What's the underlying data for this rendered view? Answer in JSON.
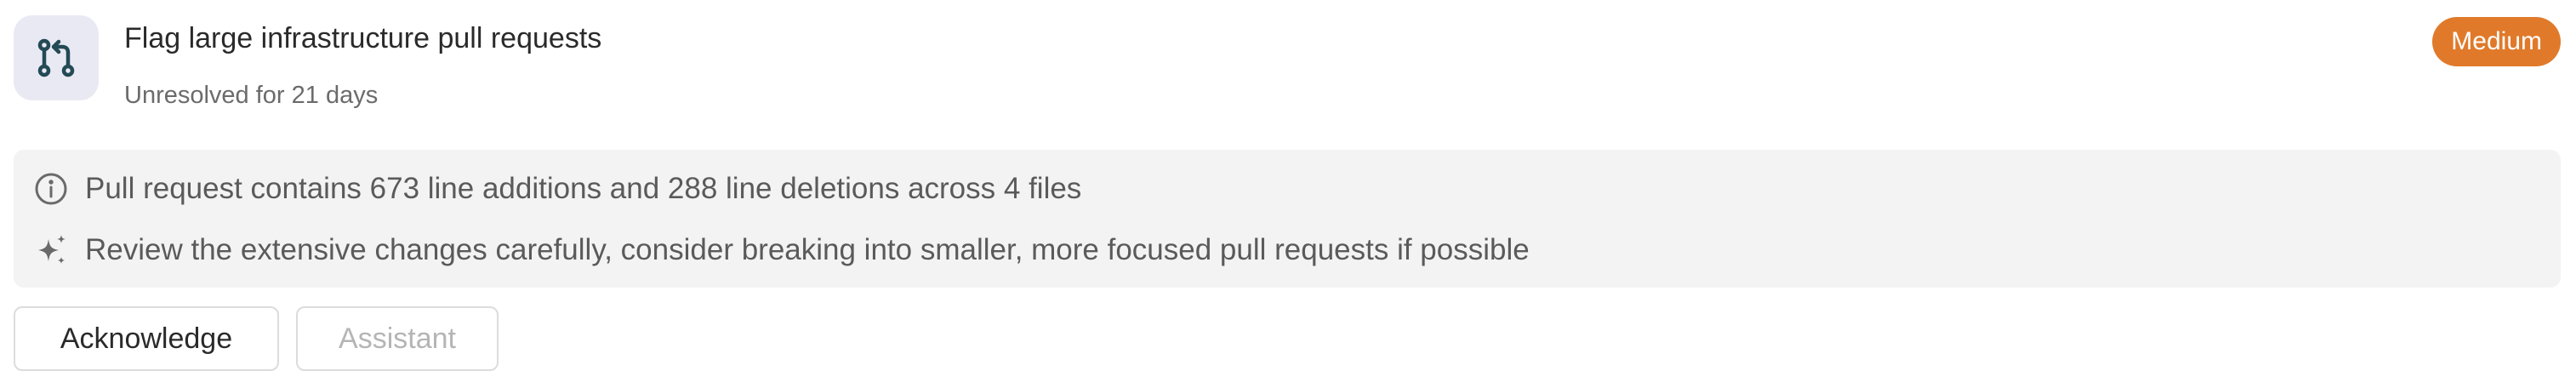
{
  "issue": {
    "title": "Flag large infrastructure pull requests",
    "status": "Unresolved for 21 days",
    "severity": "Medium",
    "icon": "pull-request-icon"
  },
  "details": [
    {
      "icon": "info-icon",
      "text": "Pull request contains 673 line additions and 288 line deletions across 4 files"
    },
    {
      "icon": "sparkle-icon",
      "text": "Review the extensive changes carefully, consider breaking into smaller, more focused pull requests if possible"
    }
  ],
  "actions": {
    "acknowledge_label": "Acknowledge",
    "assistant_label": "Assistant"
  },
  "colors": {
    "badge": "#e07a2a",
    "icon_tile": "#e9e9f4",
    "icon_stroke": "#234a55",
    "panel": "#f3f3f3"
  }
}
